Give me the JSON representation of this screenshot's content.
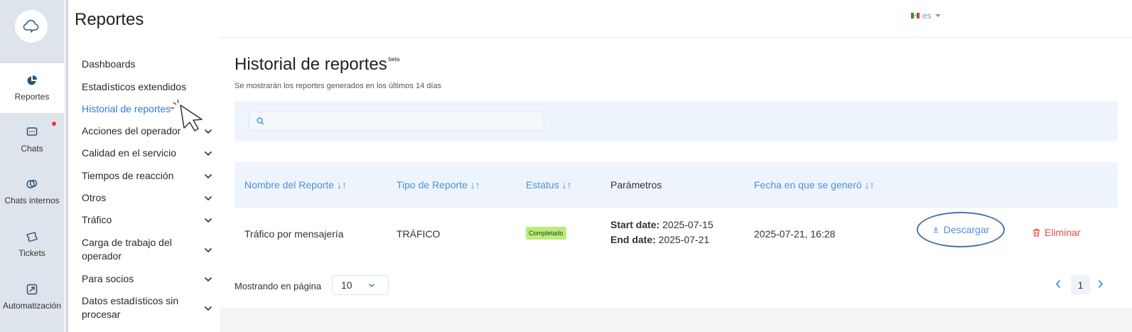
{
  "rail": {
    "items": [
      {
        "label": "Reportes",
        "icon": "pie-chart-icon",
        "active": true
      },
      {
        "label": "Chats",
        "icon": "chat-icon",
        "notification": true
      },
      {
        "label": "Chats internos",
        "icon": "internal-chat-icon"
      },
      {
        "label": "Tickets",
        "icon": "ticket-icon"
      },
      {
        "label": "Automatización",
        "icon": "automation-icon"
      }
    ]
  },
  "subnav": {
    "title": "Reportes",
    "items": [
      {
        "label": "Dashboards"
      },
      {
        "label": "Estadísticos extendidos"
      },
      {
        "label": "Historial de reportes",
        "active": true
      },
      {
        "label": "Acciones del operador"
      },
      {
        "label": "Calidad en el servicio"
      },
      {
        "label": "Tiempos de reacción"
      },
      {
        "label": "Otros"
      },
      {
        "label": "Tráfico"
      },
      {
        "label": "Carga de trabajo del operador"
      },
      {
        "label": "Para socios"
      },
      {
        "label": "Datos estadísticos sin procesar"
      }
    ]
  },
  "topbar": {
    "language": "es"
  },
  "page": {
    "title": "Historial de reportes",
    "beta": "beta",
    "subtitle": "Se mostrarán los reportes generados en los últimos 14 días",
    "search_placeholder": ""
  },
  "table": {
    "headers": {
      "name": "Nombre del Reporte",
      "type": "Tipo de Reporte",
      "status": "Estatus",
      "params": "Parámetros",
      "date": "Fecha en que se generó",
      "sort_glyph": "↓↑"
    },
    "rows": [
      {
        "name": "Tráfico por mensajería",
        "type": "TRÁFICO",
        "status": "Completado",
        "start_label": "Start date:",
        "start_value": "2025-07-15",
        "end_label": "End date:",
        "end_value": "2025-07-21",
        "date": "2025-07-21, 16:28",
        "download_label": "Descargar",
        "delete_label": "Eliminar"
      }
    ]
  },
  "pagination": {
    "per_page_label": "Mostrando en página",
    "per_page_value": "10",
    "current_page": "1"
  },
  "colors": {
    "accent": "#4f8fdf",
    "danger": "#e24b4b",
    "badge": "#b7ef77",
    "rail": "#dde4ec"
  }
}
